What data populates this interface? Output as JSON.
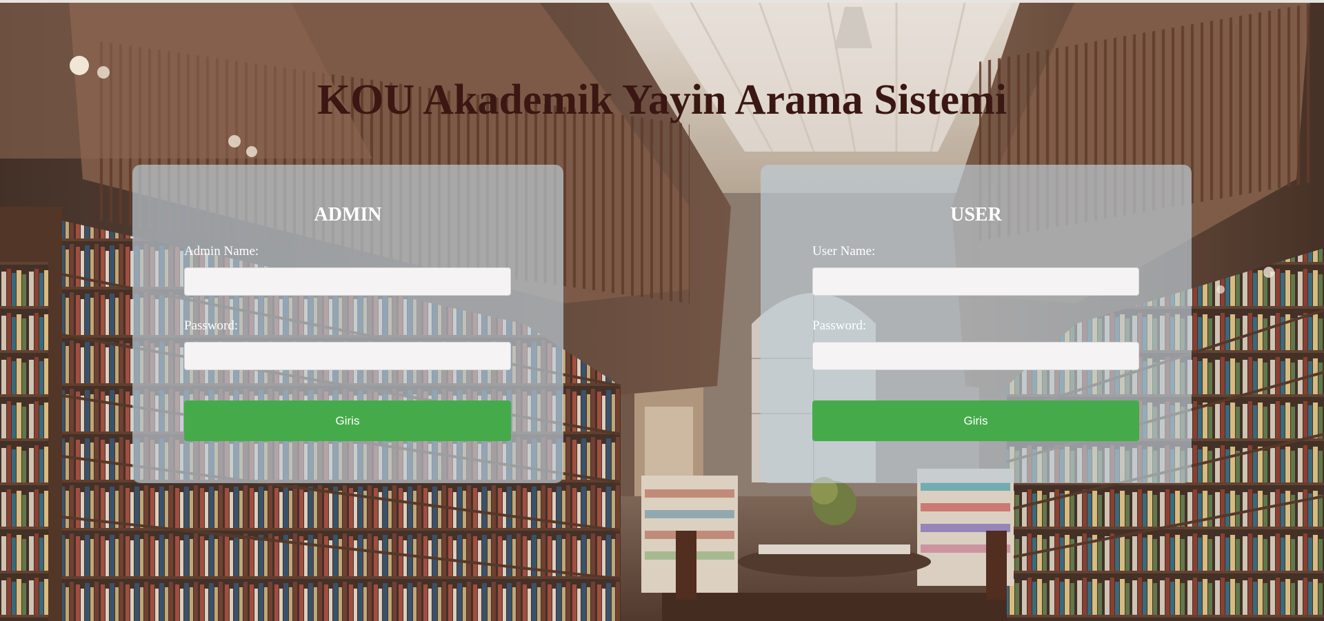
{
  "page": {
    "title": "KOU Akademik Yayin Arama Sistemi",
    "background": "library-interior-photo"
  },
  "admin_panel": {
    "heading": "ADMIN",
    "name_label": "Admin Name:",
    "password_label": "Password:",
    "name_value": "",
    "password_value": "",
    "submit_label": "Giris"
  },
  "user_panel": {
    "heading": "USER",
    "name_label": "User Name:",
    "password_label": "Password:",
    "name_value": "",
    "password_value": "",
    "submit_label": "Giris"
  },
  "colors": {
    "title": "#3a1712",
    "button": "#45ab4a",
    "panel": "rgba(190,205,215,0.68)"
  }
}
